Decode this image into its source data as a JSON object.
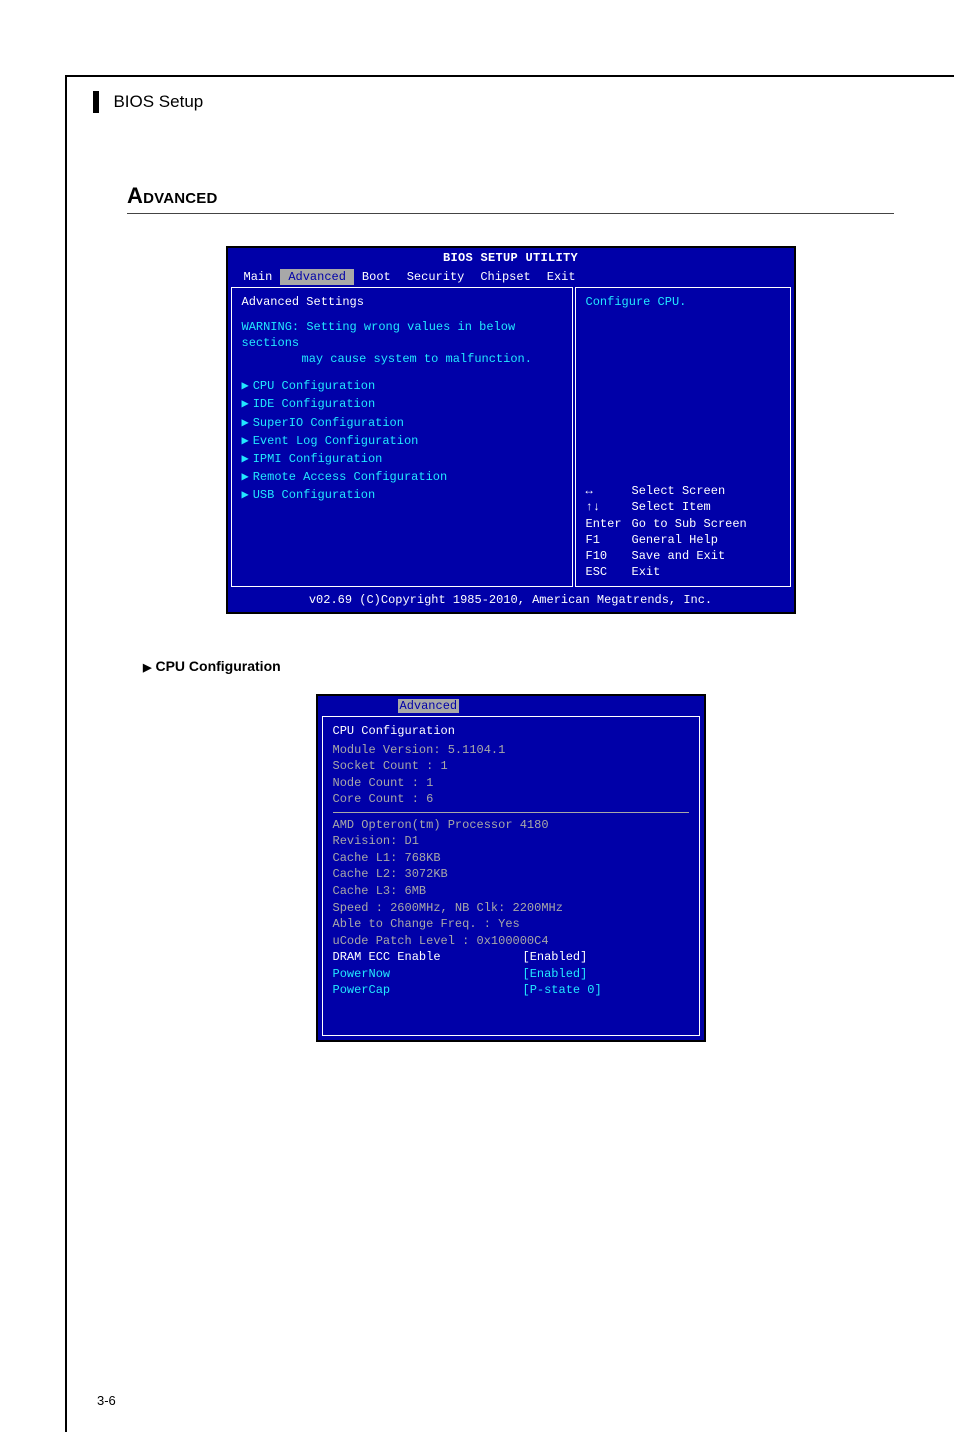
{
  "doc": {
    "header_title": "BIOS Setup",
    "section_title": "Advanced",
    "page_number": "3-6"
  },
  "bios_main": {
    "titlebar": "BIOS SETUP UTILITY",
    "tabs": [
      "Main",
      "Advanced",
      "Boot",
      "Security",
      "Chipset",
      "Exit"
    ],
    "active_tab": "Advanced",
    "panel_heading": "Advanced Settings",
    "warning_label": "WARNING:",
    "warning_line1": "Setting wrong values in below sections",
    "warning_line2": "may cause system to malfunction.",
    "menu_items": [
      "CPU Configuration",
      "IDE Configuration",
      "SuperIO Configuration",
      "Event Log Configuration",
      "IPMI Configuration",
      "Remote Access Configuration",
      "USB Configuration"
    ],
    "hint": "Configure CPU.",
    "keys": [
      {
        "key": "↔",
        "desc": "Select Screen"
      },
      {
        "key": "↑↓",
        "desc": "Select Item"
      },
      {
        "key": "Enter",
        "desc": "Go to Sub Screen"
      },
      {
        "key": "F1",
        "desc": "General Help"
      },
      {
        "key": "F10",
        "desc": "Save and Exit"
      },
      {
        "key": "ESC",
        "desc": "Exit"
      }
    ],
    "footer": "v02.69 (C)Copyright 1985-2010, American Megatrends, Inc."
  },
  "sub_heading": "CPU Configuration",
  "cpu_cfg": {
    "tab": "Advanced",
    "title": "CPU Configuration",
    "info_lines": [
      "Module Version: 5.1104.1",
      "Socket Count  : 1",
      "Node Count    : 1",
      "Core Count    : 6"
    ],
    "cpu_lines": [
      "AMD Opteron(tm) Processor 4180",
      "Revision: D1",
      "Cache L1: 768KB",
      "Cache L2: 3072KB",
      "Cache L3: 6MB",
      "Speed   : 2600MHz,    NB Clk: 2200MHz",
      "Able to Change Freq.  : Yes",
      "uCode Patch Level     : 0x100000C4"
    ],
    "options": [
      {
        "label": "DRAM ECC Enable",
        "value": "[Enabled]",
        "style": "sel"
      },
      {
        "label": "PowerNow",
        "value": "[Enabled]",
        "style": "blue"
      },
      {
        "label": "PowerCap",
        "value": "[P-state 0]",
        "style": "blue"
      }
    ]
  }
}
